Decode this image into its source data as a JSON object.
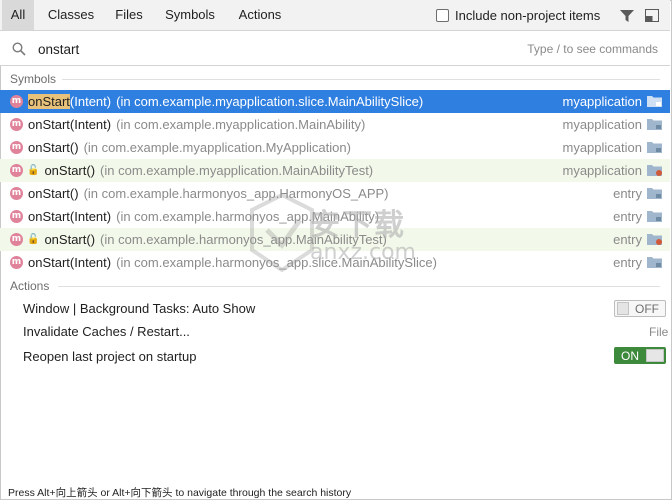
{
  "tabs": [
    "All",
    "Classes",
    "Files",
    "Symbols",
    "Actions"
  ],
  "include_non_project": "Include non-project items",
  "search": {
    "value": "onstart",
    "hint": "Type / to see commands"
  },
  "sections": {
    "symbols": "Symbols",
    "actions": "Actions"
  },
  "results": [
    {
      "name_hl": "onStart",
      "name_rest": "(Intent)",
      "ctx": "(in com.example.myapplication.slice.MainAbilitySlice)",
      "module": "myapplication",
      "selected": true,
      "test": false
    },
    {
      "name_hl": "",
      "name_rest": "onStart(Intent)",
      "ctx": "(in com.example.myapplication.MainAbility)",
      "module": "myapplication",
      "selected": false,
      "test": false
    },
    {
      "name_hl": "",
      "name_rest": "onStart()",
      "ctx": "(in com.example.myapplication.MyApplication)",
      "module": "myapplication",
      "selected": false,
      "test": false
    },
    {
      "name_hl": "",
      "name_rest": "onStart()",
      "ctx": "(in com.example.myapplication.MainAbilityTest)",
      "module": "myapplication",
      "selected": false,
      "test": true
    },
    {
      "name_hl": "",
      "name_rest": "onStart()",
      "ctx": "(in com.example.harmonyos_app.HarmonyOS_APP)",
      "module": "entry",
      "selected": false,
      "test": false
    },
    {
      "name_hl": "",
      "name_rest": "onStart(Intent)",
      "ctx": "(in com.example.harmonyos_app.MainAbility)",
      "module": "entry",
      "selected": false,
      "test": false
    },
    {
      "name_hl": "",
      "name_rest": "onStart()",
      "ctx": "(in com.example.harmonyos_app.MainAbilityTest)",
      "module": "entry",
      "selected": false,
      "test": true
    },
    {
      "name_hl": "",
      "name_rest": "onStart(Intent)",
      "ctx": "(in com.example.harmonyos_app.slice.MainAbilitySlice)",
      "module": "entry",
      "selected": false,
      "test": false
    }
  ],
  "method_icon_letter": "m",
  "actions": {
    "window_bg": "Window | Background Tasks: Auto Show",
    "window_bg_toggle": "OFF",
    "invalidate": "Invalidate Caches / Restart...",
    "invalidate_category": "File",
    "reopen": "Reopen last project on startup",
    "reopen_toggle": "ON"
  },
  "watermark": {
    "text1": "安下载",
    "text2": "anxz.com"
  },
  "status": "Press Alt+向上箭头 or Alt+向下箭头 to navigate through the search history",
  "colors": {
    "selection": "#2f7fe0",
    "test_row": "#f2f9ea",
    "toggle_on": "#3d8a3d",
    "highlight": "#e8c27a"
  }
}
